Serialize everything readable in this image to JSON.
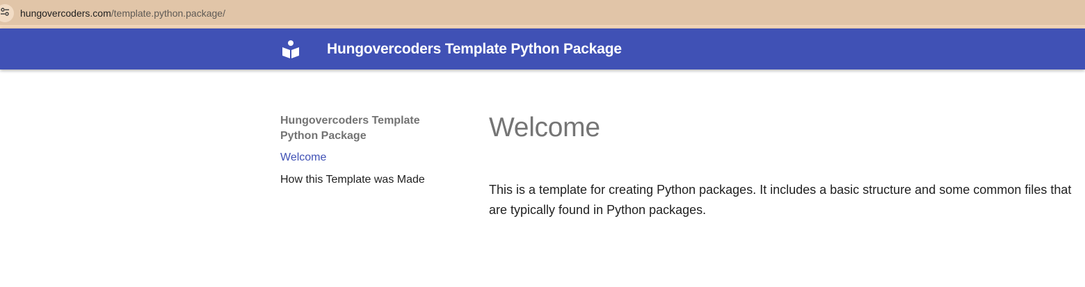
{
  "browser": {
    "url_domain": "hungovercoders.com",
    "url_path": "/template.python.package/",
    "site_info_icon": "tune-icon"
  },
  "header": {
    "logo_icon": "book-reader-icon",
    "title": "Hungovercoders Template Python Package",
    "background_color": "#4051b5"
  },
  "nav": {
    "title": "Hungovercoders Template Python Package",
    "items": [
      {
        "label": "Welcome",
        "active": true
      },
      {
        "label": "How this Template was Made",
        "active": false
      }
    ],
    "active_color": "#4051b5"
  },
  "main": {
    "heading": "Welcome",
    "paragraph": "This is a template for creating Python packages. It includes a basic structure and some common files that are typically found in Python packages."
  }
}
